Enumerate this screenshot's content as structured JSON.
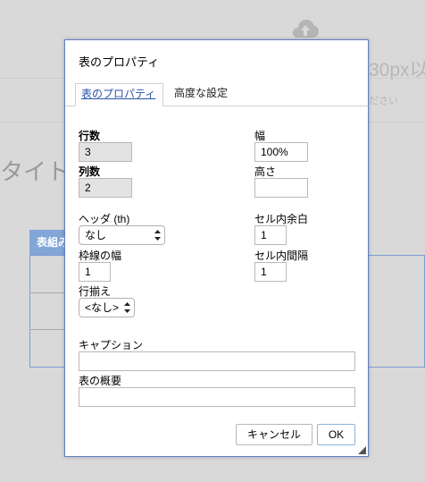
{
  "background": {
    "size_text": "30px以",
    "hint_text": "ださい",
    "title_text": "タイト",
    "table_head_text": "表組み"
  },
  "dialog": {
    "title": "表のプロパティ",
    "tabs": [
      {
        "label": "表のプロパティ",
        "active": true
      },
      {
        "label": "高度な設定",
        "active": false
      }
    ],
    "fields": {
      "rows": {
        "label": "行数",
        "value": "3"
      },
      "cols": {
        "label": "列数",
        "value": "2"
      },
      "width": {
        "label": "幅",
        "value": "100%"
      },
      "height": {
        "label": "高さ",
        "value": ""
      },
      "headers": {
        "label": "ヘッダ (th)",
        "value": "なし"
      },
      "cell_padding": {
        "label": "セル内余白",
        "value": "1"
      },
      "border_width": {
        "label": "枠線の幅",
        "value": "1"
      },
      "cell_spacing": {
        "label": "セル内間隔",
        "value": "1"
      },
      "alignment": {
        "label": "行揃え",
        "value": "<なし>"
      },
      "caption": {
        "label": "キャプション",
        "value": ""
      },
      "summary": {
        "label": "表の概要",
        "value": ""
      }
    },
    "buttons": {
      "cancel": "キャンセル",
      "ok": "OK"
    }
  },
  "colors": {
    "overlay": "#d9d9d9",
    "dialog_border": "#5f7fc9",
    "tab_active_text": "#2a52a8",
    "readonly_input": "#e3e3e3"
  }
}
